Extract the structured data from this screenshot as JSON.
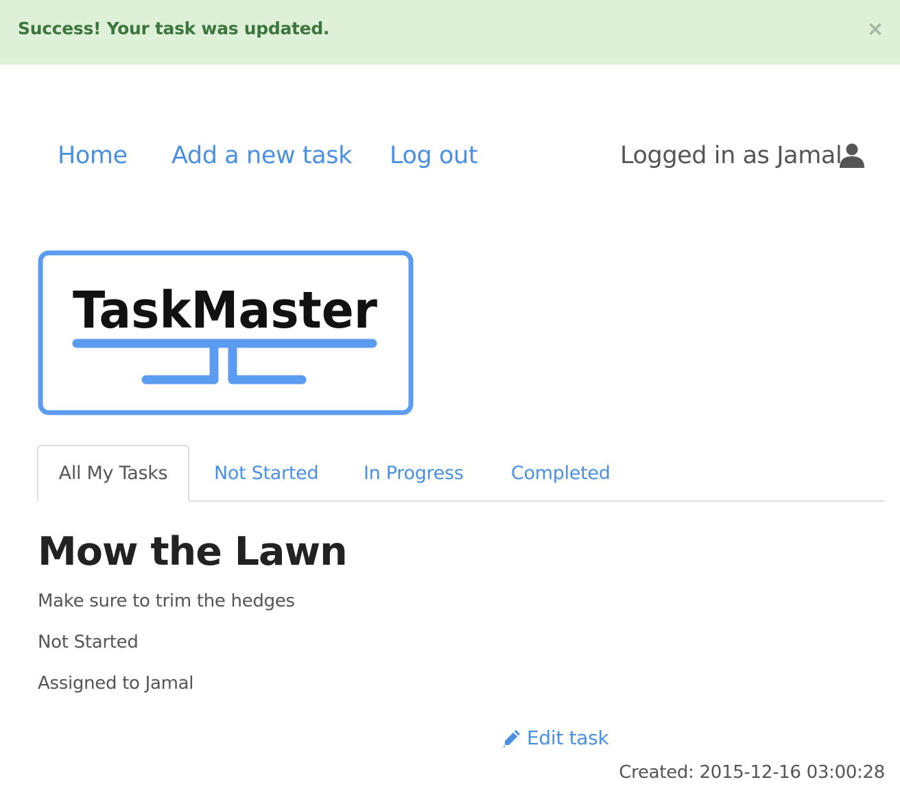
{
  "alert": {
    "message": "Success! Your task was updated.",
    "close_label": "×"
  },
  "nav": {
    "home": "Home",
    "add_task": "Add a new task",
    "logout": "Log out",
    "login_status": "Logged in as Jamal",
    "user_icon": "user-icon"
  },
  "logo": {
    "text": "TaskMaster"
  },
  "tabs": [
    {
      "label": "All My Tasks",
      "active": true
    },
    {
      "label": "Not Started",
      "active": false
    },
    {
      "label": "In Progress",
      "active": false
    },
    {
      "label": "Completed",
      "active": false
    }
  ],
  "task": {
    "title": "Mow the Lawn",
    "description": "Make sure to trim the hedges",
    "status": "Not Started",
    "assigned": "Assigned to Jamal",
    "edit_label": "Edit task",
    "edit_icon": "pencil-icon",
    "created_label": "Created:",
    "created_value": "2015-12-16 03:00:28"
  },
  "colors": {
    "link": "#4a90e2",
    "alert_bg": "#dff0d8",
    "alert_text": "#3c763d",
    "logo_blue": "#5b9bf0"
  }
}
